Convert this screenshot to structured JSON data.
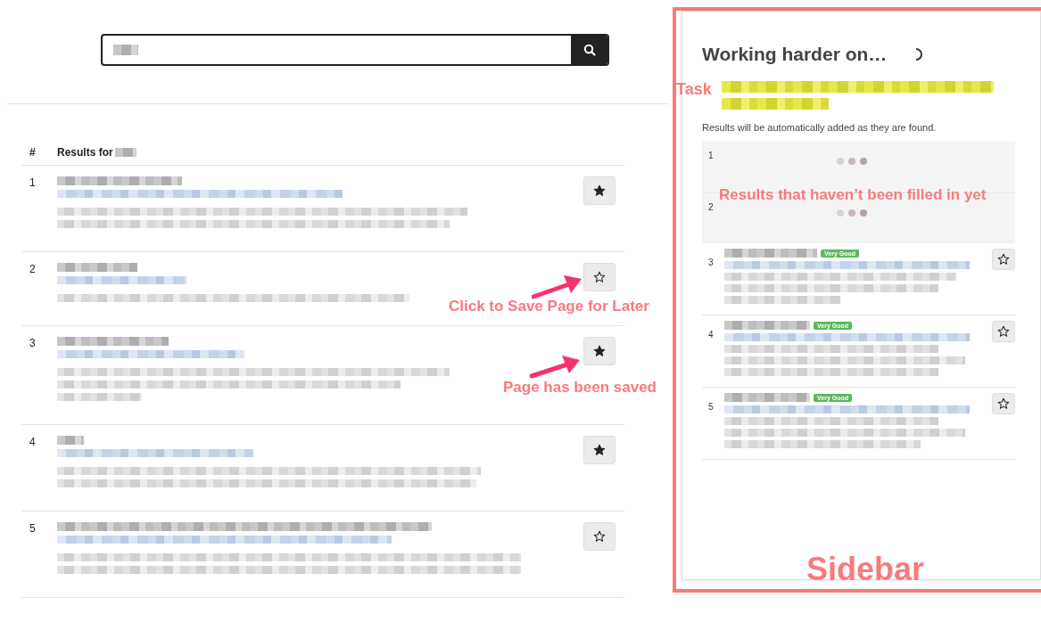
{
  "results_header": {
    "number_label": "#",
    "title": "Results for"
  },
  "results": [
    {
      "number": "1",
      "saved": true
    },
    {
      "number": "2",
      "saved": false
    },
    {
      "number": "3",
      "saved": true
    },
    {
      "number": "4",
      "saved": true
    },
    {
      "number": "5",
      "saved": false
    }
  ],
  "sidebar": {
    "title": "Working harder on…",
    "loading": true,
    "note": "Results will be automatically added as they are found.",
    "placeholders": [
      {
        "number": "1"
      },
      {
        "number": "2"
      }
    ],
    "results": [
      {
        "number": "3",
        "badge": "Very Good",
        "saved": false
      },
      {
        "number": "4",
        "badge": "Very Good",
        "saved": false
      },
      {
        "number": "5",
        "badge": "Very Good",
        "saved": false
      }
    ]
  },
  "annotations": [
    {
      "kind": "task",
      "text": "Task"
    },
    {
      "kind": "pending",
      "text": "Results that haven’t been filled in yet"
    },
    {
      "kind": "save",
      "text": "Click to Save Page for Later"
    },
    {
      "kind": "saved",
      "text": "Page has been saved"
    },
    {
      "kind": "sidebar",
      "text": "Sidebar"
    }
  ]
}
